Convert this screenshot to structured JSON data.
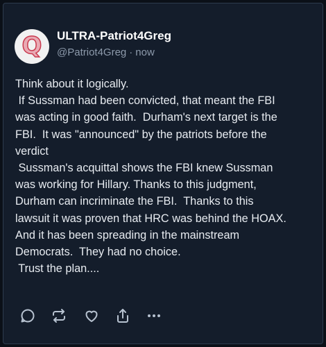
{
  "post": {
    "author_name": "ULTRA-Patriot4Greg",
    "handle": "@Patriot4Greg",
    "separator": "·",
    "time": "now",
    "avatar_logo": "Q",
    "lines": [
      "Think about it logically.",
      " If Sussman had been convicted, that meant the FBI",
      "was acting in good faith.  Durham's next target is the",
      "FBI.  It was \"announced\" by the patriots before the",
      "verdict",
      " Sussman's acquittal shows the FBI knew Sussman",
      "was working for Hillary. Thanks to this judgment,",
      "Durham can incriminate the FBI.  Thanks to this",
      "lawsuit it was proven that HRC was behind the HOAX.",
      "And it has been spreading in the mainstream",
      "Democrats.  They had no choice.",
      " Trust the plan...."
    ]
  },
  "actions": [
    {
      "name": "reply-icon"
    },
    {
      "name": "repost-icon"
    },
    {
      "name": "like-icon"
    },
    {
      "name": "share-icon"
    },
    {
      "name": "more-icon"
    }
  ],
  "colors": {
    "background": "#141d2b",
    "text": "#e7ebf0",
    "muted": "#8d9aab",
    "icon": "#b7c2d0"
  }
}
